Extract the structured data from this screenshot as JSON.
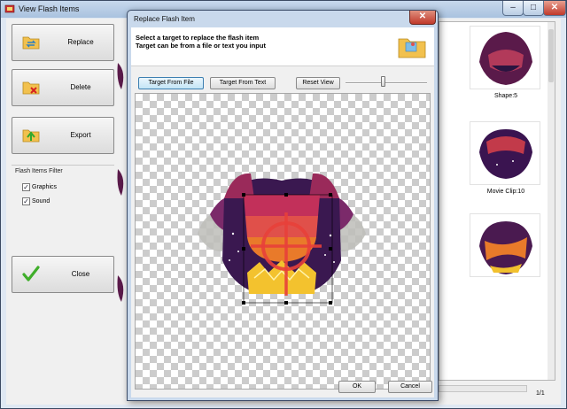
{
  "main_window": {
    "title": "View Flash Items",
    "caption_minimize": "–",
    "caption_maximize": "□",
    "caption_close": "✕"
  },
  "actions": {
    "replace_label": "Replace",
    "delete_label": "Delete",
    "export_label": "Export",
    "close_label": "Close"
  },
  "filter": {
    "title": "Flash Items Filter",
    "items": [
      {
        "label": "Graphics",
        "checked": true
      },
      {
        "label": "Sound",
        "checked": true
      }
    ]
  },
  "gallery": {
    "items": [
      {
        "label": "Shape:5"
      },
      {
        "label": "Movie Clip:10"
      }
    ],
    "pager": "1/1"
  },
  "dialog": {
    "title": "Replace Flash Item",
    "close_glyph": "✕",
    "line1": "Select a target to replace the flash item",
    "line2": "Target can be from a file or text you input",
    "buttons": {
      "from_file": "Target From File",
      "from_text": "Target From Text",
      "reset_view": "Reset View",
      "ok": "OK",
      "cancel": "Cancel"
    },
    "zoom_level": 0.5
  },
  "icons": {
    "app": "film-icon",
    "replace": "folder-swap-icon",
    "delete": "folder-delete-icon",
    "export": "folder-export-icon",
    "close": "checkmark-icon",
    "dialog_header": "folder-icon"
  },
  "colors": {
    "accent": "#3c7fb1",
    "checkmark": "#3fae2a",
    "delete_x": "#d62020"
  }
}
